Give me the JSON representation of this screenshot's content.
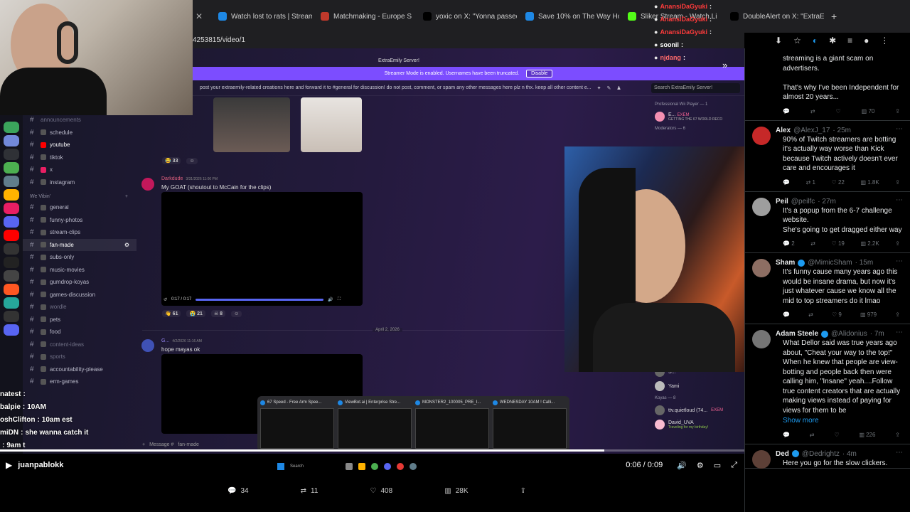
{
  "browser": {
    "tabs": [
      {
        "label": "Watch lost to rats | Stream",
        "color": "#1e88e5"
      },
      {
        "label": "Matchmaking - Europe S",
        "color": "#c0392b"
      },
      {
        "label": "yoxic on X: \"Yonna passed",
        "color": "#000000"
      },
      {
        "label": "Save 10% on The Way Ho",
        "color": "#1e88e5"
      },
      {
        "label": "Sliker Stream - Watch Li",
        "color": "#53fc18"
      },
      {
        "label": "DoubleAlert on X: \"ExtraE",
        "color": "#000000"
      }
    ],
    "url_fragment": "4253815/video/1"
  },
  "stream_chat": [
    {
      "user": "AnansiDaGyuki",
      "text": ":",
      "color": "#ff3b3b"
    },
    {
      "user": "AnansiDaGyuki",
      "text": ":",
      "color": "#ff3b3b"
    },
    {
      "user": "AnansiDaGyuki",
      "text": ":",
      "color": "#ff3b3b"
    },
    {
      "user": "soonil",
      "text": ":",
      "color": "#ffffff"
    },
    {
      "user": "njdang",
      "text": ":",
      "color": "#ff6b6b"
    }
  ],
  "stream_chat_bottom": [
    {
      "user": "natest",
      "text": ""
    },
    {
      "user": "balpie",
      "text": "10AM"
    },
    {
      "user": "oshClifton",
      "text": "10am est"
    },
    {
      "user": "miDN",
      "text": "she wanna catch it"
    },
    {
      "user": "",
      "text": "9am t"
    }
  ],
  "streamer_name": "juanpablokk",
  "discord": {
    "server_title": "ExtraEmily Server!",
    "banner_text": "Streamer Mode is enabled. Usernames have been truncated.",
    "banner_button": "Disable",
    "topic": "post your extraemily-related creations here and forward it to #general for discussion! do not post, comment, or spam any other messages here plz n thx. keep all other content e...",
    "search_placeholder": "Search ExtraEmily Server!",
    "category_top": "announcements",
    "channels_top": [
      "schedule",
      "youtube",
      "tiktok",
      "x",
      "instagram"
    ],
    "category": "We Vibin'",
    "channels": [
      {
        "name": "general",
        "dim": false,
        "active": false
      },
      {
        "name": "funny-photos",
        "dim": false,
        "active": false
      },
      {
        "name": "stream-clips",
        "dim": false,
        "active": false
      },
      {
        "name": "fan-made",
        "dim": false,
        "active": true
      },
      {
        "name": "subs-only",
        "dim": false,
        "active": false
      },
      {
        "name": "music-movies",
        "dim": false,
        "active": false
      },
      {
        "name": "gumdrop-koyas",
        "dim": false,
        "active": false
      },
      {
        "name": "games-discussion",
        "dim": false,
        "active": false
      },
      {
        "name": "wordle",
        "dim": true,
        "active": false
      },
      {
        "name": "pets",
        "dim": false,
        "active": false
      },
      {
        "name": "food",
        "dim": false,
        "active": false
      },
      {
        "name": "content-ideas",
        "dim": true,
        "active": false
      },
      {
        "name": "sports",
        "dim": true,
        "active": false
      },
      {
        "name": "accountability-please",
        "dim": false,
        "active": false
      },
      {
        "name": "erm-games",
        "dim": false,
        "active": false
      }
    ],
    "messages": [
      {
        "author": "Darkdude",
        "time": "3/31/2026 11:00 PM",
        "text": "My GOAT (shoutout to McCain for the clips)"
      },
      {
        "author": "G...",
        "time": "4/2/2026 11:16 AM",
        "text": "hope mayas ok"
      }
    ],
    "reactions_top": [
      "33",
      ""
    ],
    "reactions_video": [
      "61",
      "21",
      "8",
      ""
    ],
    "video_time": "0:17 / 0:17",
    "date_divider": "April 2, 2026",
    "message_placeholder": "Message #",
    "message_channel": "fan-made",
    "members": {
      "section1": "Professional Wii Player — 1",
      "member1": "E...",
      "member1_tag": "EXEM",
      "member1_status": "GETTING THE 67 WORLD RECO",
      "section2": "Moderators — 6",
      "member_s": "S...",
      "member_yami": "Yami",
      "section3": "Koyas — 8",
      "member_ttv": "ttv.quietloud (74...",
      "member_ttv_tag": "EXEM",
      "member_david": "David_UVA",
      "member_david_status": "Traveling for my birthday!"
    }
  },
  "previews": [
    {
      "title": "67 Speed - Free Arm Spee...",
      "color": "#1e88e5"
    },
    {
      "title": "ViewBot.ai | Enterprise Stre...",
      "color": "#1e88e5"
    },
    {
      "title": "MONSTER2_100005_PRE_I...",
      "color": "#1e88e5"
    },
    {
      "title": "WEDNESDAY 10AM ! Calli...",
      "color": "#1e88e5"
    }
  ],
  "taskbar_search": "Search",
  "player": {
    "time": "0:06 / 0:09"
  },
  "tweet_actions": {
    "replies": "34",
    "reposts": "11",
    "likes": "408",
    "views": "28K"
  },
  "x_feed": [
    {
      "name": "",
      "handle": "",
      "time": "",
      "verified": false,
      "text": "streaming is a giant scam on advertisers.\n\nThat's why I've been Independent for almost 20 years...",
      "replies": "",
      "reposts": "",
      "likes": "",
      "views": "70",
      "avatar": "#000000",
      "show_more": ""
    },
    {
      "name": "Alex",
      "handle": "@AlexJ_17",
      "time": "· 25m",
      "verified": false,
      "text": "90% of Twitch streamers are botting it's actually way worse than Kick because Twitch actively doesn't ever care and encourages it",
      "replies": "",
      "reposts": "1",
      "likes": "22",
      "views": "1.8K",
      "avatar": "#c62828",
      "show_more": ""
    },
    {
      "name": "Peil",
      "handle": "@peilfc",
      "time": "· 27m",
      "verified": false,
      "text": "It's a popup from the 6-7 challenge website.\nShe's going to get dragged either way",
      "replies": "2",
      "reposts": "",
      "likes": "19",
      "views": "2.2K",
      "avatar": "#9e9e9e",
      "show_more": ""
    },
    {
      "name": "Sham",
      "handle": "@MimicSham",
      "time": "· 15m",
      "verified": true,
      "text": "It's funny cause many years ago this would be insane drama, but now it's just whatever cause we know all the mid to top streamers do it lmao",
      "replies": "",
      "reposts": "",
      "likes": "9",
      "views": "979",
      "avatar": "#8d6e63",
      "show_more": ""
    },
    {
      "name": "Adam Steele",
      "handle": "@Alidonius",
      "time": "· 7m",
      "verified": true,
      "text": "What Dellor said was true years ago about, \"Cheat your way to the top!\" When he knew that people are view-botting and people back then were calling him, \"Insane\" yeah....Follow true content creators that are actually making views instead of paying for views for them to be",
      "replies": "",
      "reposts": "",
      "likes": "",
      "views": "226",
      "avatar": "#757575",
      "show_more": "Show more"
    },
    {
      "name": "Ded",
      "handle": "@Dedrightz",
      "time": "· 4m",
      "verified": true,
      "text": "Here you go for the slow clickers.",
      "replies": "",
      "reposts": "",
      "likes": "",
      "views": "",
      "avatar": "#5d4037",
      "show_more": ""
    }
  ]
}
